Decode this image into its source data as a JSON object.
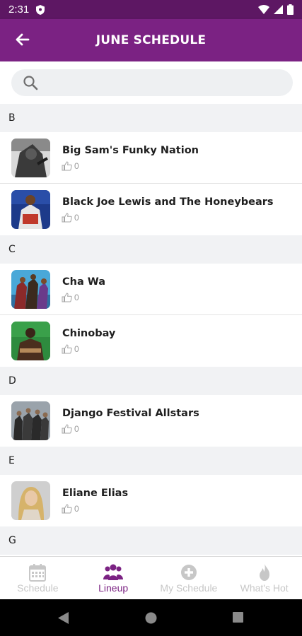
{
  "status": {
    "time": "2:31"
  },
  "header": {
    "title": "JUNE SCHEDULE"
  },
  "search": {
    "placeholder": ""
  },
  "sections": [
    {
      "letter": "B",
      "artists": [
        {
          "name": "Big Sam's Funky Nation",
          "likes": "0"
        },
        {
          "name": "Black Joe Lewis and The Honeybears",
          "likes": "0"
        }
      ]
    },
    {
      "letter": "C",
      "artists": [
        {
          "name": "Cha Wa",
          "likes": "0"
        },
        {
          "name": "Chinobay",
          "likes": "0"
        }
      ]
    },
    {
      "letter": "D",
      "artists": [
        {
          "name": "Django Festival Allstars",
          "likes": "0"
        }
      ]
    },
    {
      "letter": "E",
      "artists": [
        {
          "name": "Eliane Elias",
          "likes": "0"
        }
      ]
    },
    {
      "letter": "G",
      "artists": []
    }
  ],
  "nav": {
    "items": [
      {
        "label": "Schedule",
        "icon": "calendar-icon",
        "active": false
      },
      {
        "label": "Lineup",
        "icon": "group-icon",
        "active": true
      },
      {
        "label": "My Schedule",
        "icon": "plus-circle-icon",
        "active": false
      },
      {
        "label": "What's Hot",
        "icon": "flame-icon",
        "active": false
      }
    ]
  },
  "colors": {
    "primary": "#7b2283",
    "status_bar": "#5d1763",
    "section_bg": "#f1f2f4",
    "inactive_nav": "#c7c7c7"
  }
}
